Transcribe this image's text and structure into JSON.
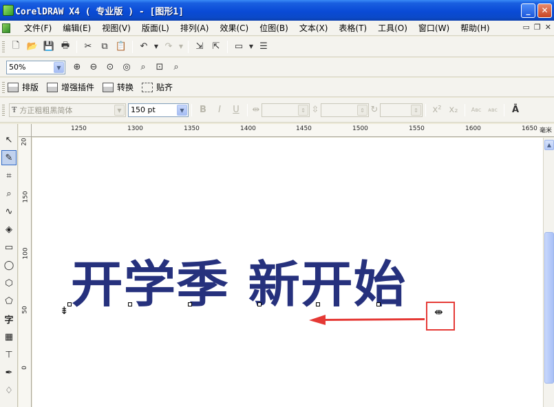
{
  "window": {
    "title": "CorelDRAW X4 ( 专业版 ) - [图形1]",
    "minimize": "_",
    "maximize": "□",
    "close": "✕"
  },
  "menu": [
    "文件(F)",
    "编辑(E)",
    "视图(V)",
    "版面(L)",
    "排列(A)",
    "效果(C)",
    "位图(B)",
    "文本(X)",
    "表格(T)",
    "工具(O)",
    "窗口(W)",
    "帮助(H)"
  ],
  "toolbar_zoom": {
    "value": "50%"
  },
  "toolbar_plugins": {
    "items": [
      "排版",
      "增强插件",
      "转换",
      "贴齐"
    ]
  },
  "text_properties": {
    "font_name": "方正粗粗黑简体",
    "font_size": "150 pt"
  },
  "ruler_top": [
    "1250",
    "1300",
    "1350",
    "1400",
    "1450",
    "1500",
    "1550",
    "1600",
    "1650"
  ],
  "ruler_unit": "毫米",
  "ruler_left": [
    "20",
    "150",
    "100",
    "50",
    "0"
  ],
  "canvas": {
    "text": "开学季 新开始",
    "text_color": "#26317d",
    "highlight_color": "#e53935"
  },
  "toolbox_icons": [
    "pick-tool",
    "shape-tool",
    "crop-tool",
    "zoom-tool",
    "freehand-tool",
    "smart-fill-tool",
    "rectangle-tool",
    "ellipse-tool",
    "polygon-tool",
    "basic-shapes-tool",
    "text-tool",
    "table-tool",
    "dimension-tool",
    "eyedropper-tool",
    "outline-tool"
  ],
  "toolbox_text_tool_label": "字"
}
